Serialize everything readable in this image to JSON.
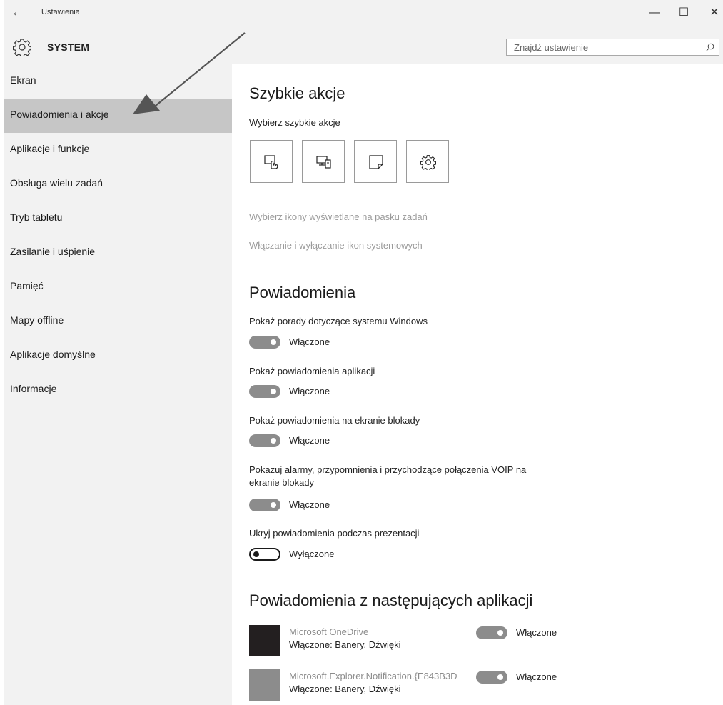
{
  "window": {
    "title": "Ustawienia",
    "back_glyph": "←",
    "minimize_glyph": "—",
    "maximize_glyph": "☐",
    "close_glyph": "✕"
  },
  "header": {
    "title": "SYSTEM",
    "icon": "gear-icon",
    "search_placeholder": "Znajdź ustawienie",
    "search_icon": "search-icon"
  },
  "sidebar": {
    "items": [
      {
        "label": "Ekran",
        "active": false
      },
      {
        "label": "Powiadomienia i akcje",
        "active": true
      },
      {
        "label": "Aplikacje i funkcje",
        "active": false
      },
      {
        "label": "Obsługa wielu zadań",
        "active": false
      },
      {
        "label": "Tryb tabletu",
        "active": false
      },
      {
        "label": "Zasilanie i uśpienie",
        "active": false
      },
      {
        "label": "Pamięć",
        "active": false
      },
      {
        "label": "Mapy offline",
        "active": false
      },
      {
        "label": "Aplikacje domyślne",
        "active": false
      },
      {
        "label": "Informacje",
        "active": false
      }
    ]
  },
  "quick_actions": {
    "heading": "Szybkie akcje",
    "subheading": "Wybierz szybkie akcje",
    "tiles": [
      "tablet-mode-icon",
      "connect-icon",
      "note-icon",
      "settings-gear-icon"
    ],
    "link_taskbar": "Wybierz ikony wyświetlane na pasku zadań",
    "link_system_icons": "Włączanie i wyłączanie ikon systemowych"
  },
  "notifications": {
    "heading": "Powiadomienia",
    "settings": [
      {
        "label": "Pokaż porady dotyczące systemu Windows",
        "state": "Włączone",
        "on": true
      },
      {
        "label": "Pokaż powiadomienia aplikacji",
        "state": "Włączone",
        "on": true
      },
      {
        "label": "Pokaż powiadomienia na ekranie blokady",
        "state": "Włączone",
        "on": true
      },
      {
        "label": "Pokazuj alarmy, przypomnienia i przychodzące połączenia VOIP na",
        "label2": "ekranie blokady",
        "state": "Włączone",
        "on": true
      },
      {
        "label": "Ukryj powiadomienia podczas prezentacji",
        "state": "Wyłączone",
        "on": false
      }
    ]
  },
  "apps": {
    "heading": "Powiadomienia z następujących aplikacji",
    "items": [
      {
        "name": "Microsoft OneDrive",
        "detail": "Włączone: Banery, Dźwięki",
        "state": "Włączone",
        "on": true,
        "icon_color": "#231f20"
      },
      {
        "name": "Microsoft.Explorer.Notification.{E843B3D",
        "detail": "Włączone: Banery, Dźwięki",
        "state": "Włączone",
        "on": true,
        "icon_color": "#8c8c8c"
      }
    ]
  }
}
